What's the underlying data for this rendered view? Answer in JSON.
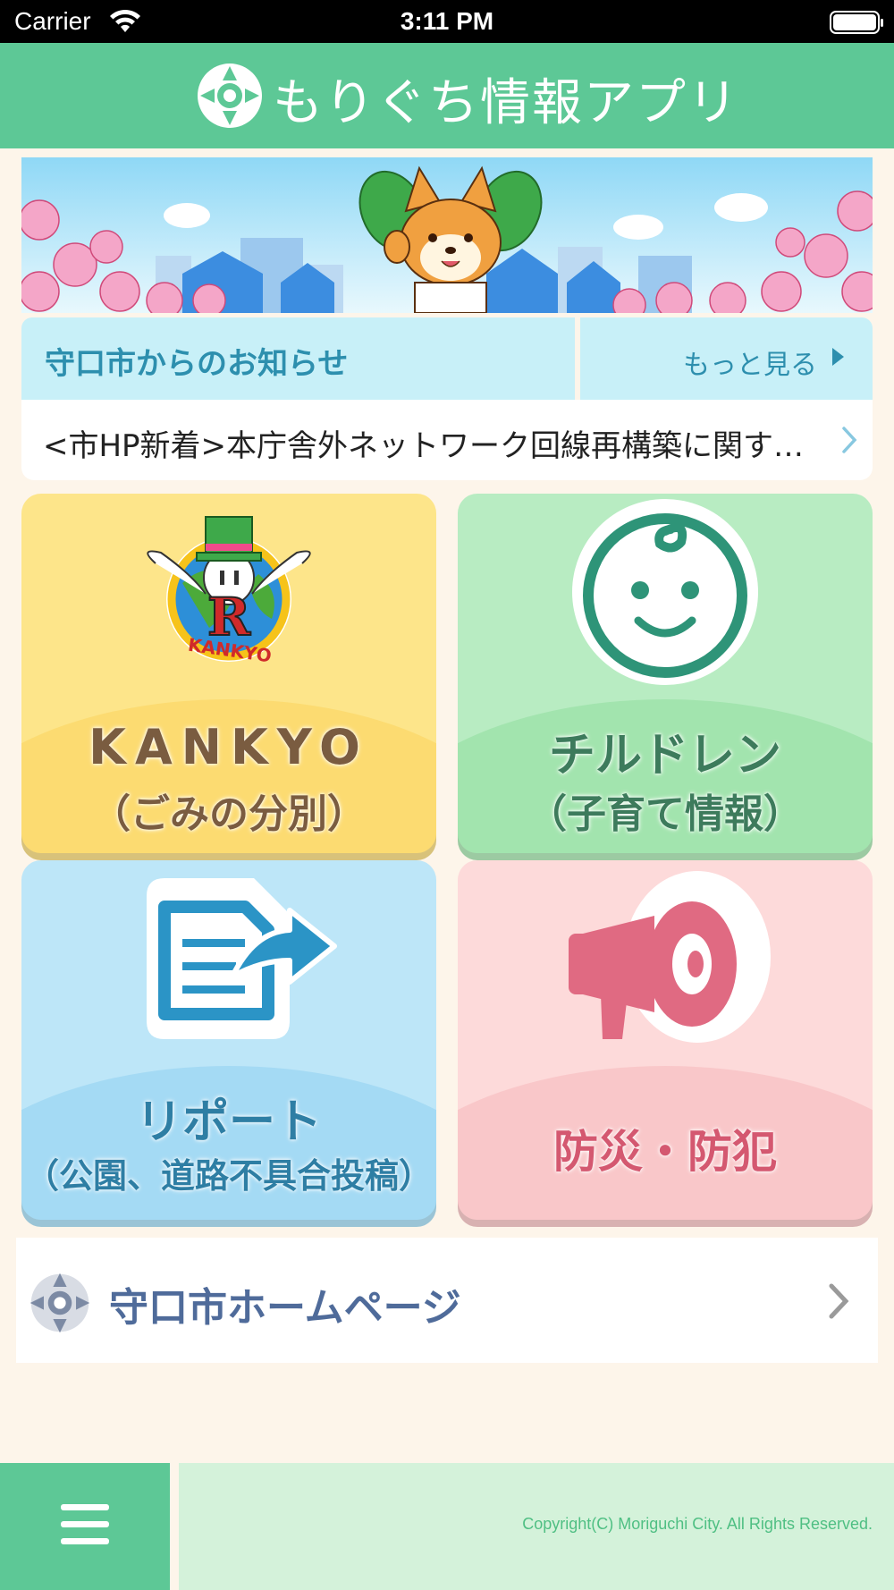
{
  "status_bar": {
    "carrier": "Carrier",
    "time": "3:11 PM"
  },
  "header": {
    "title": "もりぐち情報アプリ"
  },
  "banner": {
    "description_icon": "mascot-banner-illustration"
  },
  "notice": {
    "title": "守口市からのお知らせ",
    "more_label": "もっと見る",
    "items": [
      {
        "text": "<市HP新着>本庁舎外ネットワーク回線再構築に関す…"
      }
    ]
  },
  "tiles": {
    "kankyo": {
      "line1": "KANKYO",
      "line2": "（ごみの分別）",
      "icon": "kankyo-mascot-icon",
      "emblem_text": "KANKYO",
      "emblem_letter": "R"
    },
    "children": {
      "line1": "チルドレン",
      "line2": "（子育て情報）",
      "icon": "baby-face-icon"
    },
    "report": {
      "line1": "リポート",
      "line2": "（公園、道路不具合投稿）",
      "icon": "document-share-icon"
    },
    "bousai": {
      "line1": "防災・防犯",
      "icon": "megaphone-icon"
    }
  },
  "homepage_link": {
    "label": "守口市ホームページ"
  },
  "footer": {
    "copyright": "Copyright(C) Moriguchi City. All Rights Reserved."
  },
  "colors": {
    "brand_green": "#5dc896",
    "notice_blue": "#c8f0f8",
    "kankyo_yellow": "#fde58a",
    "children_green": "#b8ecc2",
    "report_blue": "#bde6f8",
    "bousai_pink": "#fddada"
  }
}
